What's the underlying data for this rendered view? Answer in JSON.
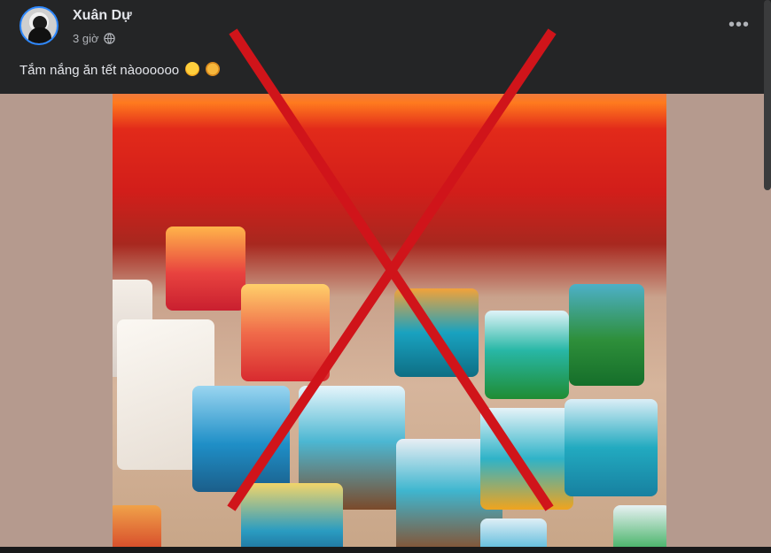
{
  "post": {
    "author": "Xuân Dự",
    "time": "3 giờ",
    "privacy_icon": "globe-icon",
    "text": "Tắm nắng ăn tết nàoooooo",
    "emojis": [
      "smiling-face-emoji",
      "gift-emoji"
    ],
    "more_label": "•••"
  },
  "photo": {
    "subject": "resin keycaps",
    "overlay": "red-x-mark"
  },
  "colors": {
    "background": "#242526",
    "text": "#e4e6eb",
    "secondary_text": "#b0b3b8",
    "avatar_ring": "#2d88ff",
    "x_mark": "#d0141a"
  }
}
